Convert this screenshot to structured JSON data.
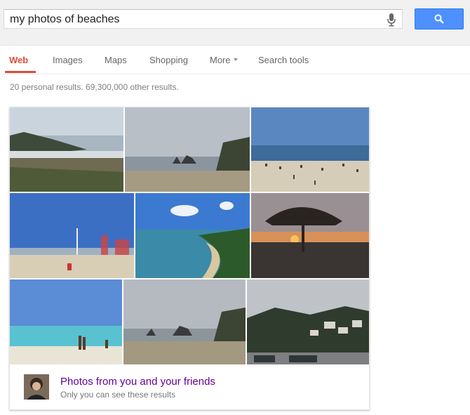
{
  "search": {
    "query": "my photos of beaches",
    "mic_icon": "microphone-icon",
    "button_icon": "magnifier-icon",
    "button_color": "#4d90fe"
  },
  "tabs": [
    {
      "label": "Web",
      "active": true
    },
    {
      "label": "Images"
    },
    {
      "label": "Maps"
    },
    {
      "label": "Shopping"
    },
    {
      "label": "More"
    },
    {
      "label": "Search tools"
    }
  ],
  "stats": "20 personal results. 69,300,000 other results.",
  "accent_color": "#dd4b39",
  "link_color": "#660099",
  "photos": [
    {
      "subject": "coastal cliff beach"
    },
    {
      "subject": "sea stacks beach"
    },
    {
      "subject": "crowded beach"
    },
    {
      "subject": "boardwalk amusement beach"
    },
    {
      "subject": "tropical bay"
    },
    {
      "subject": "sunset palapa"
    },
    {
      "subject": "turquoise water swimmers"
    },
    {
      "subject": "sea stacks overcast"
    },
    {
      "subject": "hillside town parking lot"
    }
  ],
  "footer": {
    "title": "Photos from you and your friends",
    "subtitle": "Only you can see these results"
  }
}
